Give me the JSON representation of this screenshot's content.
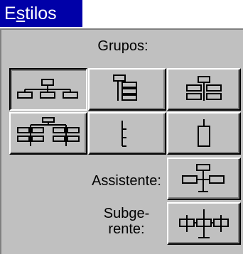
{
  "title": {
    "prefix": "E",
    "underlined": "s",
    "rest": "tilos"
  },
  "groups_header": "Grupos:",
  "assistant_label": "Assistente:",
  "submanager_label_line1": "Subge-",
  "submanager_label_line2": "rente:",
  "colors": {
    "title_bg": "#0000a8",
    "panel_bg": "#c0c0c0"
  }
}
